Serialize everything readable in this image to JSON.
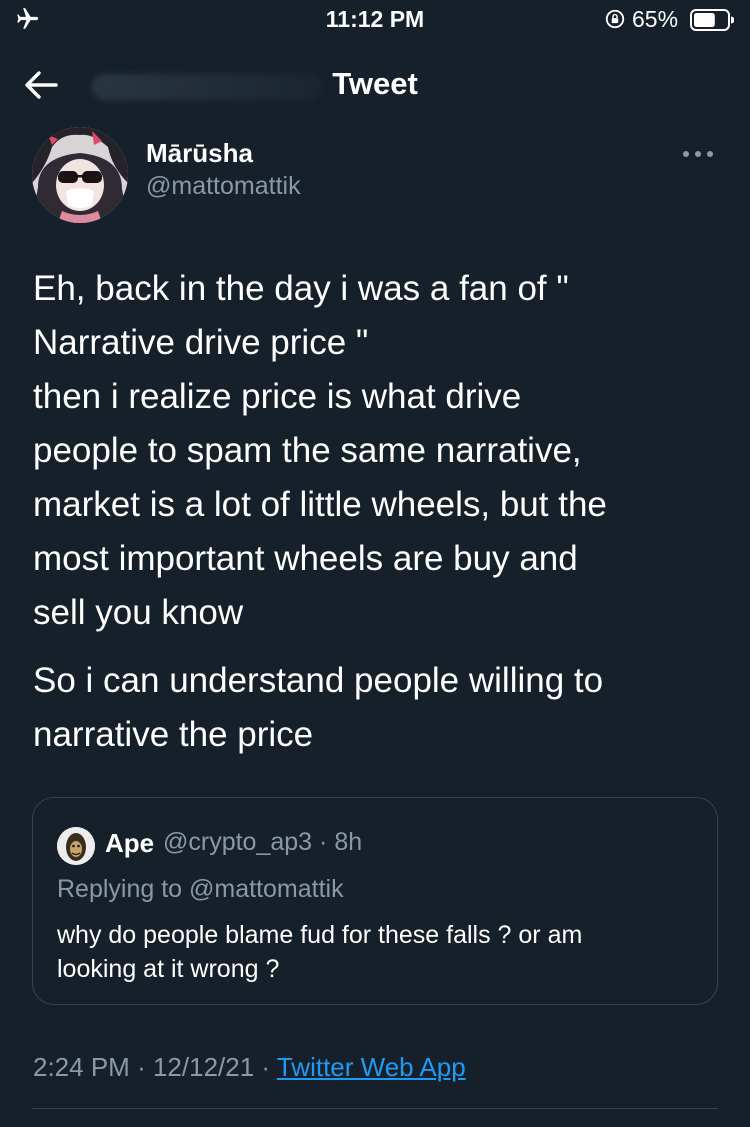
{
  "status_bar": {
    "time": "11:12 PM",
    "battery_percent": "65%",
    "battery_level": 0.65,
    "airplane_icon": "airplane-icon",
    "rotation_lock_icon": "rotation-lock-icon"
  },
  "header": {
    "title": "Tweet",
    "back_icon": "arrow-left-icon"
  },
  "tweet": {
    "author_name": "Mārūsha",
    "author_handle": "@mattomattik",
    "lines_p1": [
      "Eh, back in the day i was a fan of \"",
      "Narrative drive price \"",
      "then i realize price is what drive",
      "people to spam the same narrative,",
      "market is a lot of little wheels, but the",
      "most important wheels are buy and",
      "sell you know"
    ],
    "lines_p2": [
      "So i can understand people willing to",
      "narrative the price"
    ],
    "time": "2:24 PM",
    "separator": "·",
    "date": "12/12/21",
    "source": "Twitter Web App"
  },
  "quoted_tweet": {
    "name": "Ape",
    "handle": "@crypto_ap3",
    "separator": "·",
    "age": "8h",
    "replying_prefix": "Replying to",
    "replying_to": "@mattomattik",
    "lines": [
      "why do people blame fud for these falls ? or am",
      "looking at it wrong ?"
    ]
  },
  "colors": {
    "background": "#15202b",
    "secondary_text": "#8b98a5",
    "link": "#1d9bf0",
    "border": "#38444d"
  }
}
